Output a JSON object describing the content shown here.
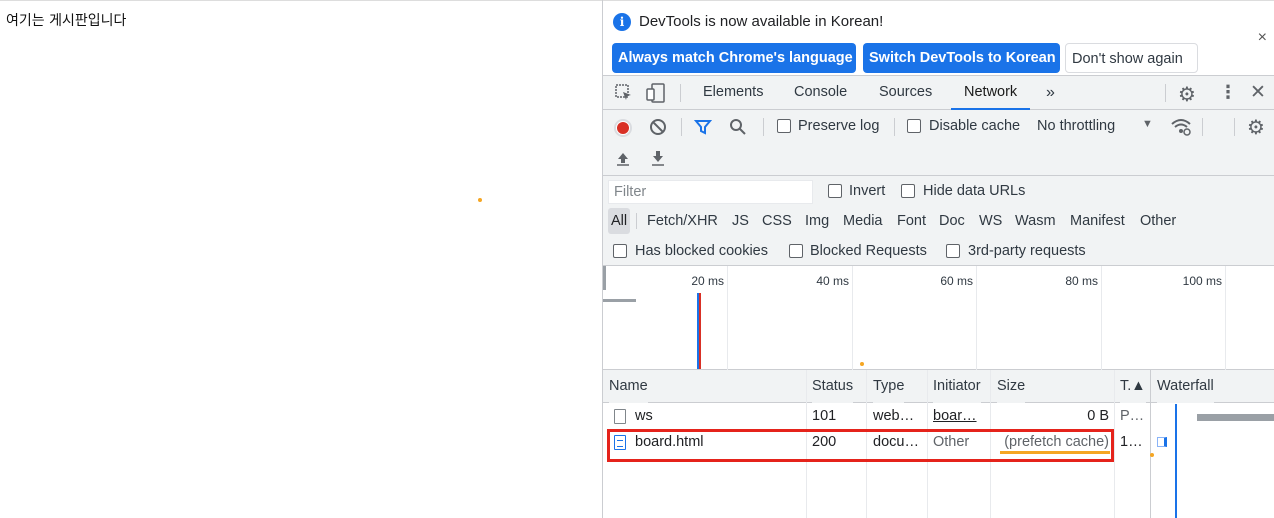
{
  "page": {
    "text": "여기는 게시판입니다"
  },
  "infobar": {
    "message": "DevTools is now available in Korean!",
    "btn_match": "Always match Chrome's language",
    "btn_switch": "Switch DevTools to Korean",
    "btn_dont_show": "Don't show again",
    "close": "×"
  },
  "tabs": {
    "items": [
      "Elements",
      "Console",
      "Sources",
      "Network"
    ],
    "active": "Network",
    "more": "»"
  },
  "toolbar": {
    "preserve_log": "Preserve log",
    "disable_cache": "Disable cache",
    "throttling": "No throttling"
  },
  "filter": {
    "placeholder": "Filter",
    "invert": "Invert",
    "hide_data_urls": "Hide data URLs",
    "types": [
      "All",
      "Fetch/XHR",
      "JS",
      "CSS",
      "Img",
      "Media",
      "Font",
      "Doc",
      "WS",
      "Wasm",
      "Manifest",
      "Other"
    ],
    "active_type": "All",
    "has_blocked_cookies": "Has blocked cookies",
    "blocked_requests": "Blocked Requests",
    "third_party": "3rd-party requests"
  },
  "overview": {
    "ticks": [
      "20 ms",
      "40 ms",
      "60 ms",
      "80 ms",
      "100 ms"
    ]
  },
  "table": {
    "columns": [
      "Name",
      "Status",
      "Type",
      "Initiator",
      "Size",
      "T.▲",
      "Waterfall"
    ],
    "rows": [
      {
        "name": "ws",
        "status": "101",
        "type": "web…",
        "initiator": "boar…",
        "size": "0 B",
        "time": "P…"
      },
      {
        "name": "board.html",
        "status": "200",
        "type": "docu…",
        "initiator": "Other",
        "size": "(prefetch cache)",
        "time": "1…"
      }
    ]
  },
  "colors": {
    "accent": "#1a73e8",
    "record": "#d93025",
    "highlight": "#e5231b",
    "marker": "#f5a623"
  }
}
